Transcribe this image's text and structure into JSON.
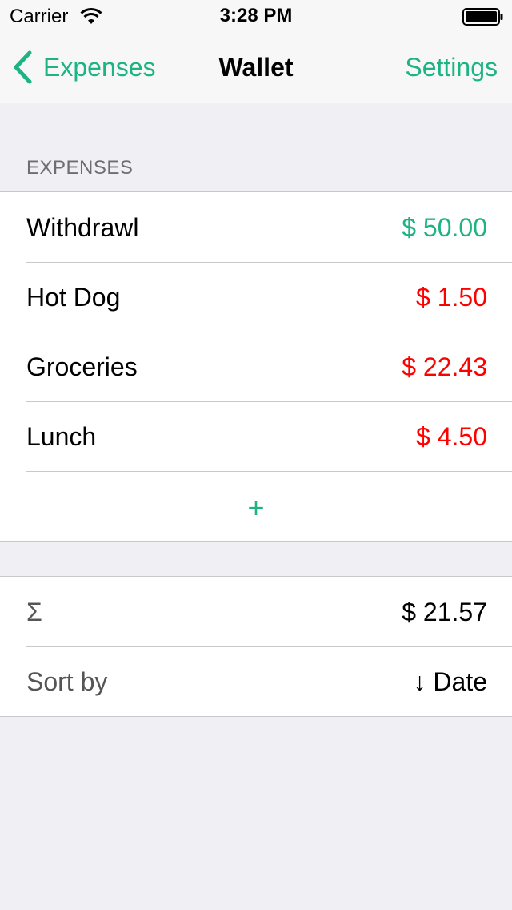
{
  "status_bar": {
    "carrier": "Carrier",
    "time": "3:28 PM"
  },
  "nav": {
    "back_label": "Expenses",
    "title": "Wallet",
    "settings_label": "Settings"
  },
  "expenses_section": {
    "header": "EXPENSES",
    "items": [
      {
        "title": "Withdrawl",
        "amount": "$ 50.00",
        "kind": "income"
      },
      {
        "title": "Hot Dog",
        "amount": "$ 1.50",
        "kind": "expense"
      },
      {
        "title": "Groceries",
        "amount": "$ 22.43",
        "kind": "expense"
      },
      {
        "title": "Lunch",
        "amount": "$ 4.50",
        "kind": "expense"
      }
    ],
    "add_label": "+"
  },
  "summary_section": {
    "sum_label": "Σ",
    "sum_value": "$ 21.57",
    "sort_label": "Sort by",
    "sort_value": "↓ Date"
  },
  "colors": {
    "accent": "#1db383",
    "negative": "#ff0000",
    "background": "#efeff4"
  },
  "icons": [
    "wifi-icon",
    "battery-icon",
    "chevron-left-icon"
  ]
}
